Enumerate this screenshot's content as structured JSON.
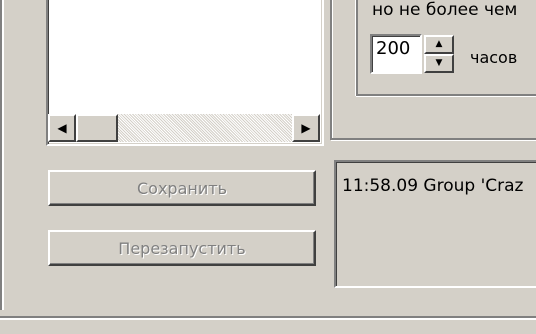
{
  "schedule": {
    "hint_text": "но не более чем",
    "hours_value": "200",
    "hours_label": "часов"
  },
  "buttons": {
    "save_label": "Сохранить",
    "restart_label": "Перезапустить"
  },
  "log": {
    "line1": "11:58.09 Group 'Craz"
  },
  "icons": {
    "scroll_left": "arrow-left-icon",
    "scroll_right": "arrow-right-icon",
    "spin_up": "arrow-up-icon",
    "spin_down": "arrow-down-icon"
  },
  "colors": {
    "window_bg": "#d4d0c8",
    "disabled_text": "#808080"
  }
}
